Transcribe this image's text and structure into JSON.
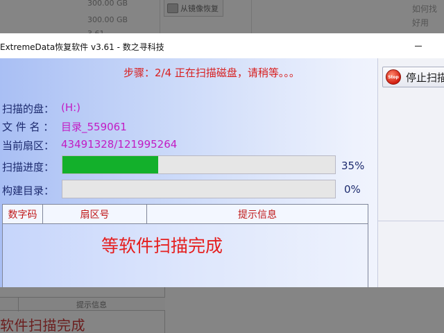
{
  "background_app": {
    "disk_sizes": [
      "300.00 GB",
      "300.00 GB",
      "3.61"
    ],
    "image_restore_button": "从镜像恢复",
    "help_lines": [
      "如何找",
      "好用"
    ],
    "table_header": "提示信息",
    "status_message": "软件扫描完成"
  },
  "window": {
    "title": "ExtremeData恢复软件 v3.61   - 数之寻科技",
    "minimize_icon": "minimize-icon"
  },
  "scan": {
    "step_text": "步骤：2/4 正在扫描磁盘，请稍等。。。",
    "disk_label": "扫描的盘：",
    "disk_value": "(H:)",
    "filename_label": "文 件 名 ：",
    "filename_value": "目录_559061",
    "sector_label": "当前扇区：",
    "sector_value": "43491328/121995264",
    "progress_label": "扫描进度：",
    "progress_value": 0.35,
    "progress_text": "35%",
    "build_label": "构建目录：",
    "build_value": 0.0,
    "build_text": "0%",
    "progress_color": "#13b02b"
  },
  "stop_button": {
    "icon_text": "Stop",
    "label": "停止扫描"
  },
  "log": {
    "columns": [
      "数字码",
      "扇区号",
      "提示信息"
    ],
    "message": "等软件扫描完成"
  },
  "colors": {
    "step_text": "#d81e1e",
    "value_text": "#c21cc4",
    "label_text": "#1c2a6e",
    "log_message": "#e51e1e"
  }
}
